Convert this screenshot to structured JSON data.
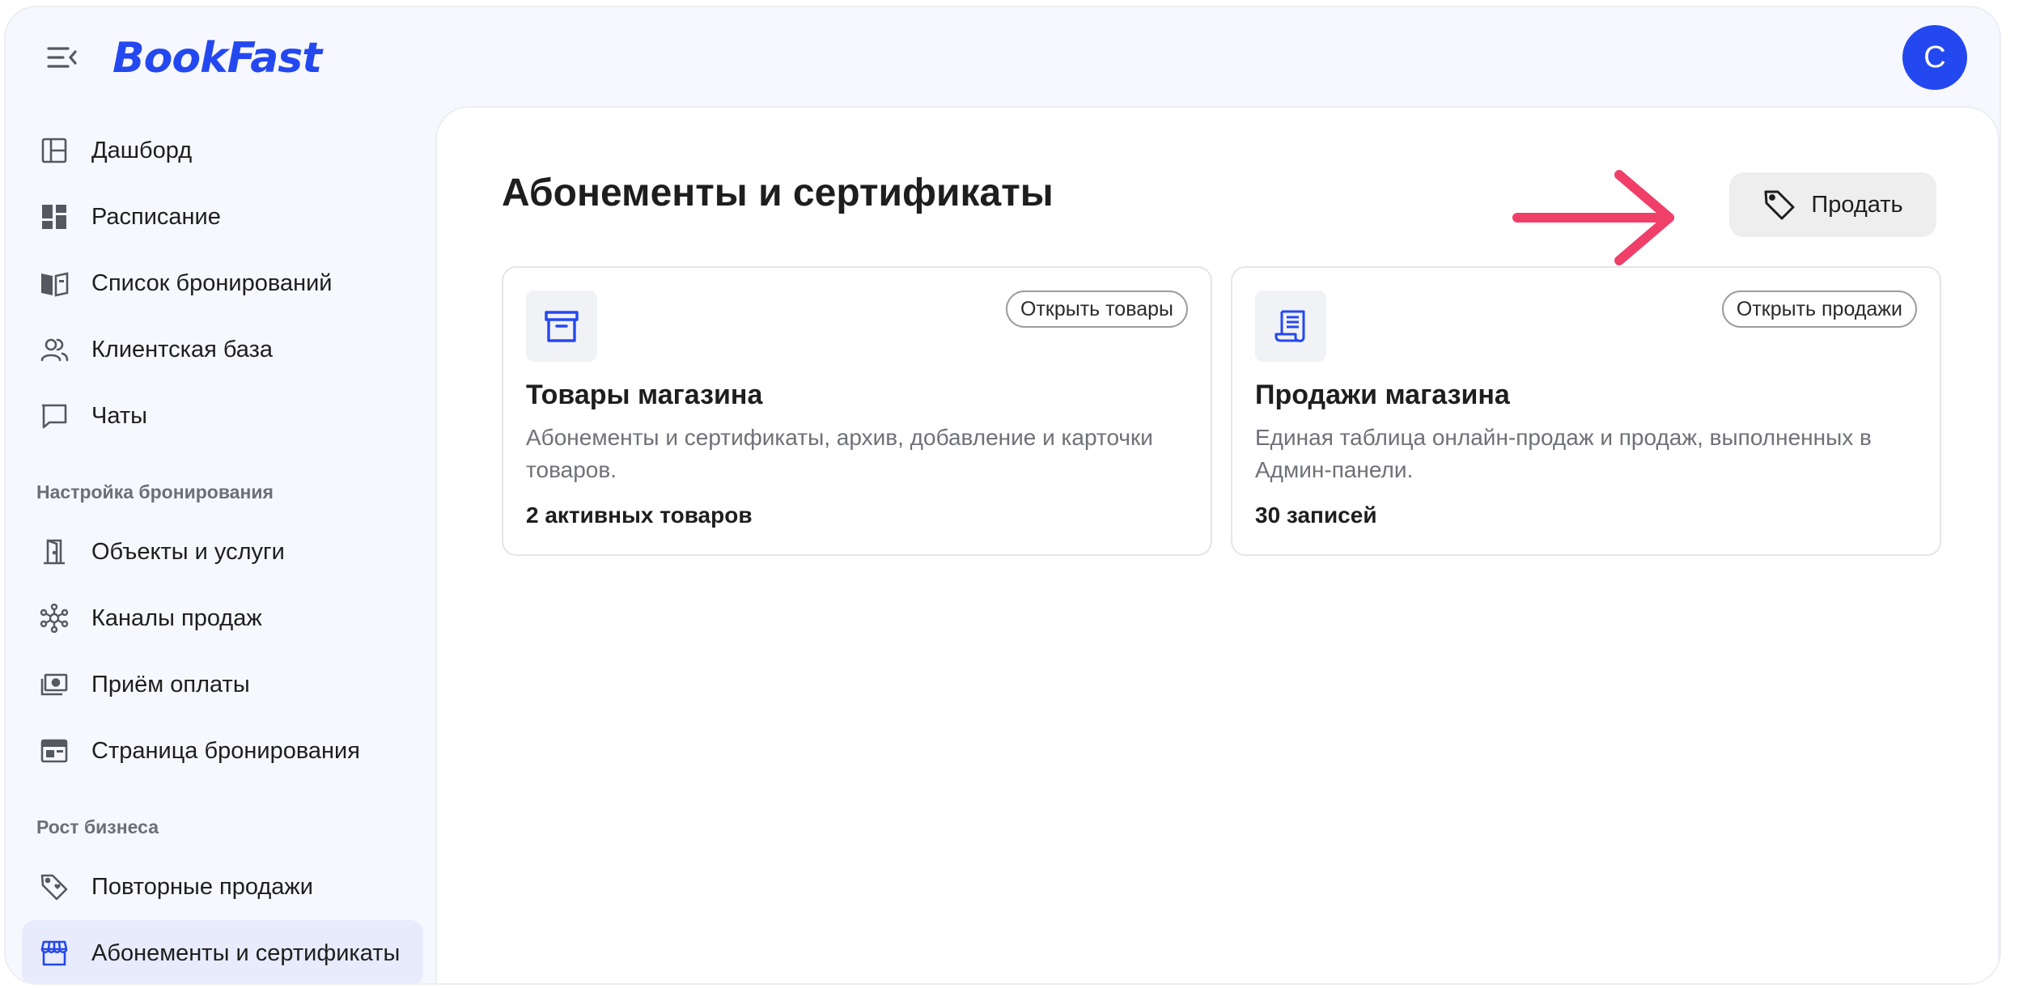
{
  "app": {
    "logo_text": "BookFast",
    "avatar_initial": "С"
  },
  "sidebar": {
    "items": [
      {
        "label": "Дашборд",
        "icon": "layout-icon"
      },
      {
        "label": "Расписание",
        "icon": "dashboard-grid-icon"
      },
      {
        "label": "Список бронирований",
        "icon": "book-open-icon"
      },
      {
        "label": "Клиентская база",
        "icon": "users-icon"
      },
      {
        "label": "Чаты",
        "icon": "chat-icon"
      }
    ],
    "group_booking": "Настройка бронирования",
    "booking_items": [
      {
        "label": "Объекты и услуги",
        "icon": "door-icon"
      },
      {
        "label": "Каналы продаж",
        "icon": "network-icon"
      },
      {
        "label": "Приём оплаты",
        "icon": "money-icon"
      },
      {
        "label": "Страница бронирования",
        "icon": "browser-icon"
      }
    ],
    "group_growth": "Рост бизнеса",
    "growth_items": [
      {
        "label": "Повторные продажи",
        "icon": "tag-heart-icon"
      },
      {
        "label": "Абонементы и сертификаты",
        "icon": "store-icon",
        "active": true
      }
    ]
  },
  "main": {
    "title": "Абонементы и сертификаты",
    "sell_button": "Продать",
    "cards": [
      {
        "button": "Открыть товары",
        "title": "Товары магазина",
        "description": "Абонементы и сертификаты, архив, добавление и карточки товаров.",
        "count": "2 активных товаров",
        "icon": "archive-box-icon"
      },
      {
        "button": "Открыть продажи",
        "title": "Продажи магазина",
        "description": "Единая таблица онлайн-продаж и продаж, выполненных в Админ-панели.",
        "count": "30 записей",
        "icon": "receipt-icon"
      }
    ]
  },
  "colors": {
    "accent": "#2448f0",
    "annotation_arrow": "#f0406a"
  }
}
